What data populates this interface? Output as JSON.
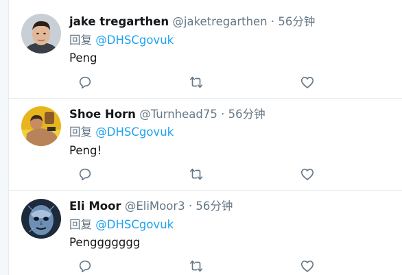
{
  "tweets": [
    {
      "name": "jake tregarthen",
      "handle": "@jaketregarthen",
      "dot": "·",
      "time": "56分钟",
      "reply_prefix": "回复",
      "reply_to": "@DHSCgovuk",
      "text": "Peng",
      "avatar": "avatar-photo-man"
    },
    {
      "name": "Shoe Horn",
      "handle": "@Turnhead75",
      "dot": "·",
      "time": "56分钟",
      "reply_prefix": "回复",
      "reply_to": "@DHSCgovuk",
      "text": "Peng!",
      "avatar": "avatar-photo-yellow"
    },
    {
      "name": "Eli Moor",
      "handle": "@EliMoor3",
      "dot": "·",
      "time": "56分钟",
      "reply_prefix": "回复",
      "reply_to": "@DHSCgovuk",
      "text": "Penggggggg",
      "avatar": "avatar-photo-blue-mask"
    }
  ],
  "icons": {
    "reply": "reply-icon",
    "retweet": "retweet-icon",
    "like": "heart-icon"
  },
  "colors": {
    "mention": "#1da1f2",
    "secondary_text": "#657786",
    "primary_text": "#14171a",
    "divider": "#e6ecf0"
  }
}
